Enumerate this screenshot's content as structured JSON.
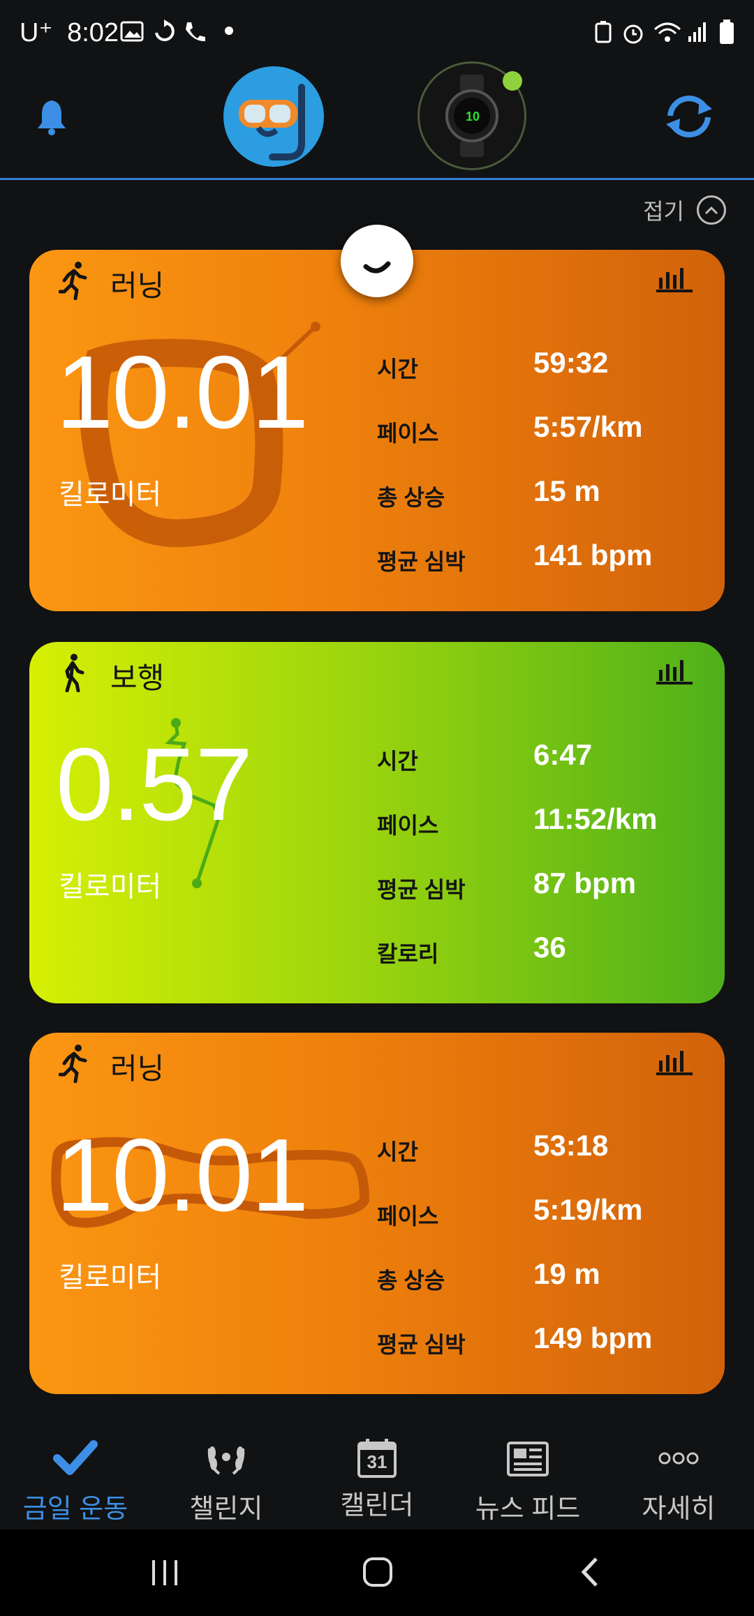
{
  "status_bar": {
    "time": "8:02",
    "carrier": "U⁺"
  },
  "header": {
    "notification_icon": "bell-icon",
    "avatar_icon": "snorkel-mask-icon",
    "device_icon": "smartwatch-icon",
    "sync_icon": "sync-icon",
    "device_status_color": "#8fd13c"
  },
  "collapse_label": "접기",
  "activities": [
    {
      "type": "러닝",
      "distance": "10.01",
      "unit": "킬로미터",
      "color": "orange",
      "stats": [
        {
          "label": "시간",
          "value": "59:32"
        },
        {
          "label": "페이스",
          "value": "5:57/km"
        },
        {
          "label": "총 상승",
          "value": "15 m"
        },
        {
          "label": "평균 심박",
          "value": "141 bpm"
        }
      ]
    },
    {
      "type": "보행",
      "distance": "0.57",
      "unit": "킬로미터",
      "color": "green",
      "stats": [
        {
          "label": "시간",
          "value": "6:47"
        },
        {
          "label": "페이스",
          "value": "11:52/km"
        },
        {
          "label": "평균 심박",
          "value": "87 bpm"
        },
        {
          "label": "칼로리",
          "value": "36"
        }
      ]
    },
    {
      "type": "러닝",
      "distance": "10.01",
      "unit": "킬로미터",
      "color": "orange",
      "stats": [
        {
          "label": "시간",
          "value": "53:18"
        },
        {
          "label": "페이스",
          "value": "5:19/km"
        },
        {
          "label": "총 상승",
          "value": "19 m"
        },
        {
          "label": "평균 심박",
          "value": "149 bpm"
        }
      ]
    }
  ],
  "bottom_nav": [
    {
      "label": "금일 운동",
      "icon": "check-icon",
      "active": true
    },
    {
      "label": "챌린지",
      "icon": "laurel-icon",
      "active": false
    },
    {
      "label": "캘린더",
      "icon": "calendar-icon",
      "calendar_day": "31",
      "active": false
    },
    {
      "label": "뉴스 피드",
      "icon": "newspaper-icon",
      "active": false
    },
    {
      "label": "자세히",
      "icon": "more-icon",
      "active": false
    }
  ],
  "colors": {
    "accent": "#3d8fe5",
    "orange_card": "#ee800c",
    "green_card": "#9fd60d"
  }
}
